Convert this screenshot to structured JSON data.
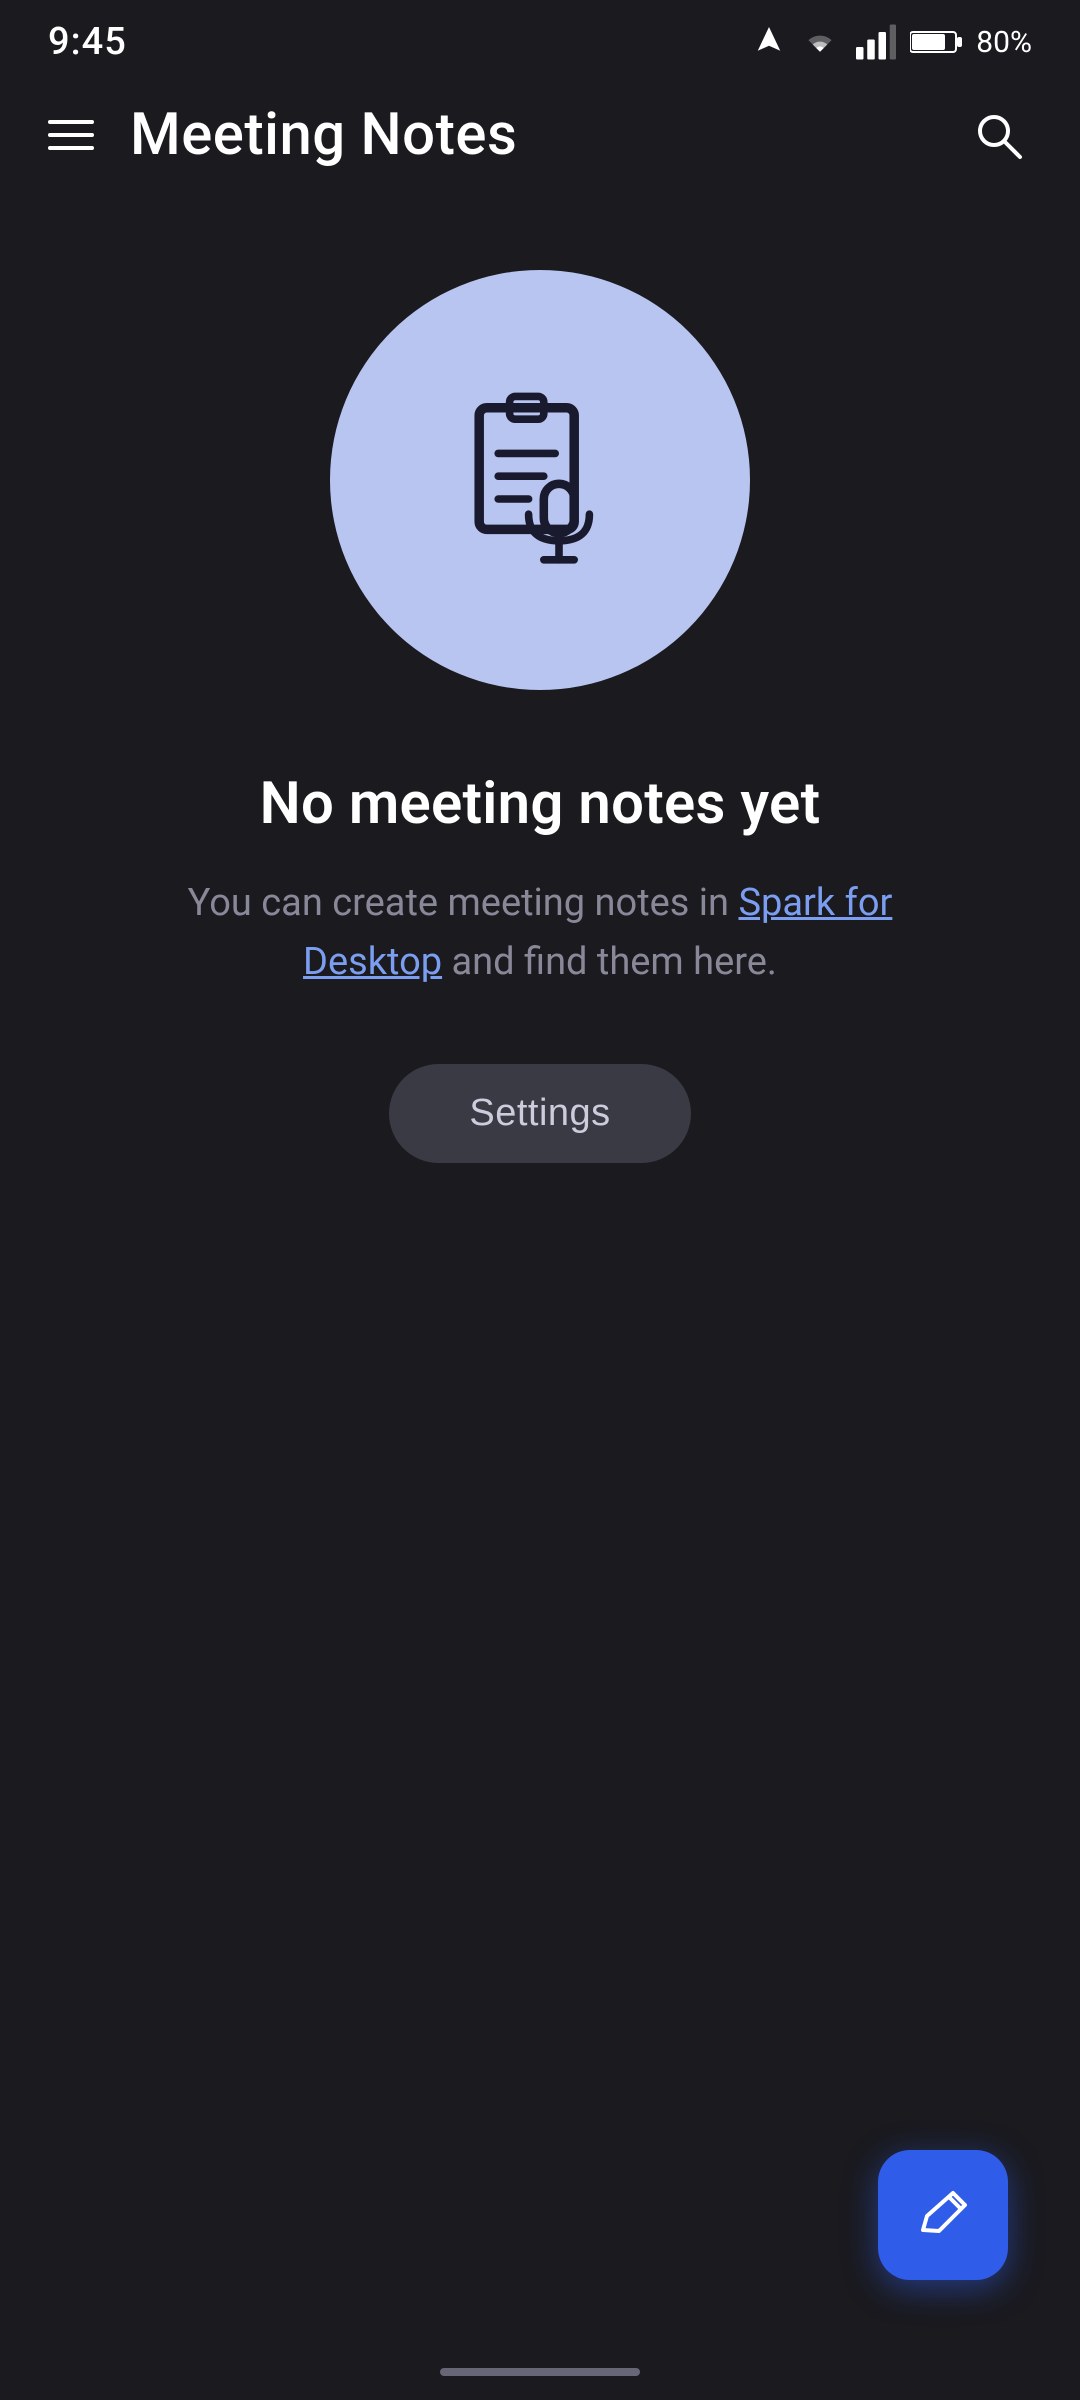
{
  "statusBar": {
    "time": "9:45",
    "battery": "80%",
    "batteryLevel": 80
  },
  "header": {
    "title": "Meeting Notes",
    "menuLabel": "menu",
    "searchLabel": "search"
  },
  "emptyState": {
    "iconLabel": "meeting-notes-icon",
    "title": "No meeting notes yet",
    "descriptionPrefix": "You can create meeting notes in ",
    "linkText": "Spark for Desktop",
    "descriptionSuffix": " and find them here."
  },
  "buttons": {
    "settings": "Settings",
    "fab": "compose"
  },
  "colors": {
    "circleBackground": "#b8c5f0",
    "fabBackground": "#2f5ce8",
    "settingsBackground": "#3a3a45",
    "linkColor": "#7b9ef0"
  }
}
